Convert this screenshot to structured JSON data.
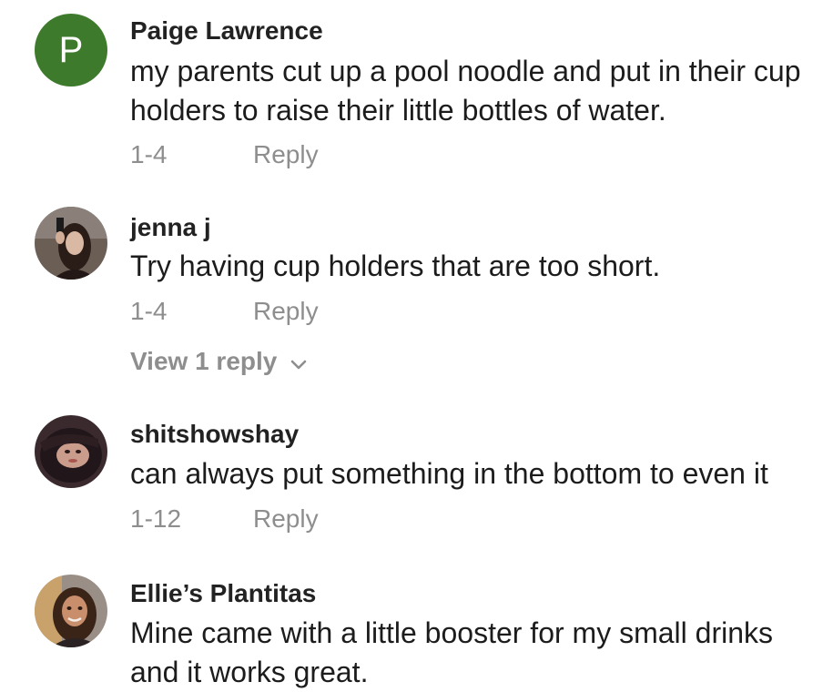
{
  "comments": [
    {
      "author": "Paige Lawrence",
      "avatar_letter": "P",
      "text": "my parents cut up a pool noodle and put in their cup holders to raise their little bottles of water.",
      "date": "1-4",
      "reply_label": "Reply"
    },
    {
      "author": "jenna j",
      "text": "Try having cup holders that are too short.",
      "date": "1-4",
      "reply_label": "Reply",
      "view_replies_label": "View 1 reply"
    },
    {
      "author": "shitshowshay",
      "text": "can always put something in the bottom to even it",
      "date": "1-12",
      "reply_label": "Reply"
    },
    {
      "author": "Ellie’s Plantitas",
      "text": "Mine came with a little booster for my small drinks and it works great."
    }
  ],
  "colors": {
    "avatar_letter_bg": "#3e7a2c",
    "meta_text": "#8e8e8e"
  },
  "icons": {
    "view_replies": "chevron-down-icon"
  }
}
